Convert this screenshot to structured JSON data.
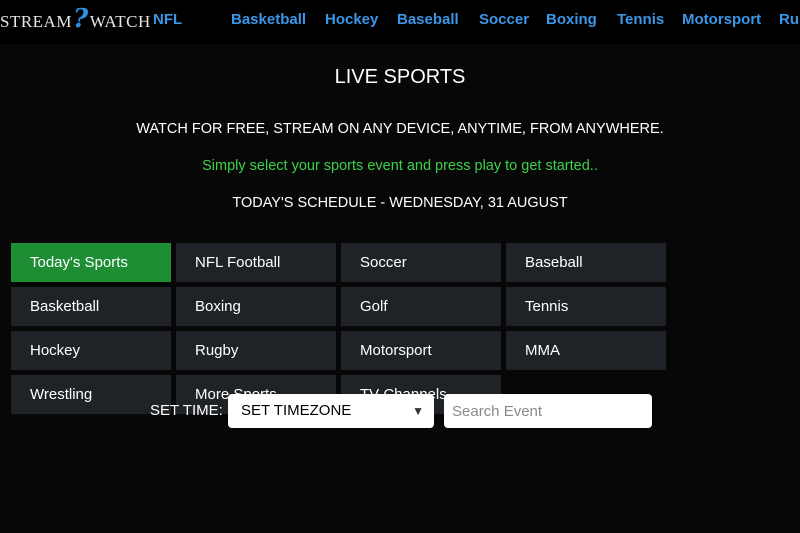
{
  "header": {
    "logo_left": "STREAM",
    "logo_mark": "?",
    "logo_right": "WATCH",
    "nav": [
      "NFL",
      "Basketball",
      "Hockey",
      "Baseball",
      "Soccer",
      "Boxing",
      "Tennis",
      "Motorsport",
      "Ru"
    ]
  },
  "content": {
    "title": "LIVE SPORTS",
    "tagline": "WATCH FOR FREE, STREAM ON ANY DEVICE, ANYTIME, FROM ANYWHERE.",
    "instruction": "Simply select your sports event and press play to get started..",
    "schedule": "TODAY'S SCHEDULE - WEDNESDAY, 31 AUGUST"
  },
  "categories": [
    "Today's Sports",
    "NFL Football",
    "Soccer",
    "Baseball",
    "Basketball",
    "Boxing",
    "Golf",
    "Tennis",
    "Hockey",
    "Rugby",
    "Motorsport",
    "MMA",
    "Wrestling",
    "More Sports",
    "TV Channels"
  ],
  "active_category": "Today's Sports",
  "controls": {
    "set_time_label": "SET TIME:",
    "timezone_value": "SET TIMEZONE",
    "search_placeholder": "Search Event"
  },
  "colors": {
    "background": "#000000",
    "nav_link": "#3d95e6",
    "active_tile": "#1e8e34",
    "tile": "#1f2226",
    "instruction_text": "#3ed24a"
  }
}
